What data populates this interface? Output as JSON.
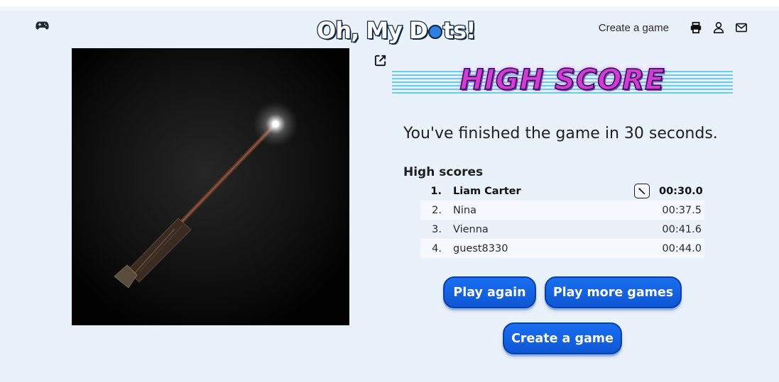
{
  "header": {
    "logo_text_before": "Oh, My D",
    "logo_text_after": "ts!",
    "nav_create_label": "Create a game",
    "icons": [
      "gamepad-icon",
      "print-icon",
      "user-icon",
      "mail-icon"
    ]
  },
  "image_panel": {
    "description_icon": "magic-wand-image",
    "open_icon": "external-link-icon"
  },
  "result": {
    "banner": "HIGH SCORE",
    "message": "You've finished the game in 30 seconds.",
    "scores_heading": "High scores",
    "scores": [
      {
        "rank": "1.",
        "name": "Liam Carter",
        "time": "00:30.0",
        "current": true
      },
      {
        "rank": "2.",
        "name": "Nina",
        "time": "00:37.5",
        "current": false
      },
      {
        "rank": "3.",
        "name": "Vienna",
        "time": "00:41.6",
        "current": false
      },
      {
        "rank": "4.",
        "name": "guest8330",
        "time": "00:44.0",
        "current": false
      }
    ]
  },
  "buttons": {
    "play_again": "Play again",
    "play_more": "Play more games",
    "create_game": "Create a game"
  },
  "colors": {
    "background": "#e9f1fa",
    "button_blue": "#1565e8",
    "banner_pink": "#d63ad6",
    "banner_lines": "#5ac8f0"
  }
}
